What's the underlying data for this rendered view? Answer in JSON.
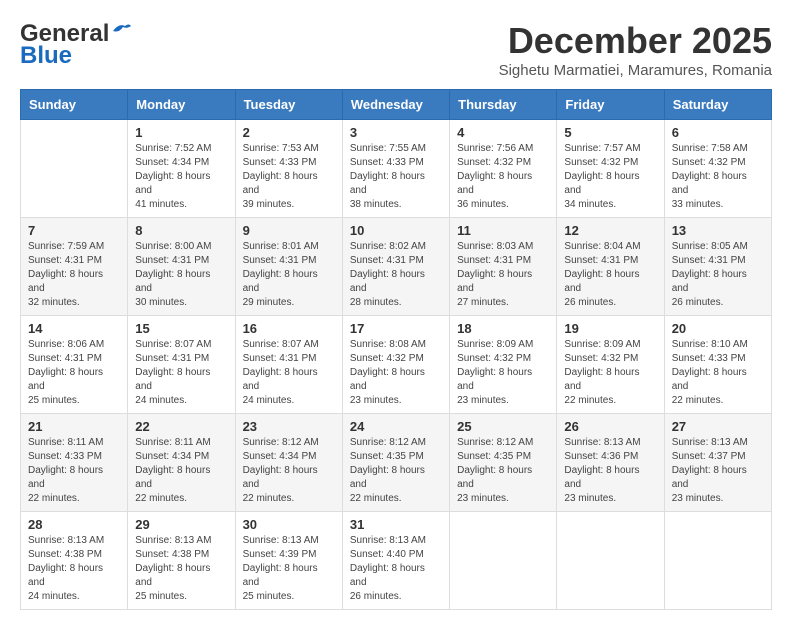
{
  "logo": {
    "general": "General",
    "blue": "Blue"
  },
  "title": "December 2025",
  "location": "Sighetu Marmatiei, Maramures, Romania",
  "days_of_week": [
    "Sunday",
    "Monday",
    "Tuesday",
    "Wednesday",
    "Thursday",
    "Friday",
    "Saturday"
  ],
  "weeks": [
    [
      {
        "day": "",
        "sunrise": "",
        "sunset": "",
        "daylight": ""
      },
      {
        "day": "1",
        "sunrise": "Sunrise: 7:52 AM",
        "sunset": "Sunset: 4:34 PM",
        "daylight": "Daylight: 8 hours and 41 minutes."
      },
      {
        "day": "2",
        "sunrise": "Sunrise: 7:53 AM",
        "sunset": "Sunset: 4:33 PM",
        "daylight": "Daylight: 8 hours and 39 minutes."
      },
      {
        "day": "3",
        "sunrise": "Sunrise: 7:55 AM",
        "sunset": "Sunset: 4:33 PM",
        "daylight": "Daylight: 8 hours and 38 minutes."
      },
      {
        "day": "4",
        "sunrise": "Sunrise: 7:56 AM",
        "sunset": "Sunset: 4:32 PM",
        "daylight": "Daylight: 8 hours and 36 minutes."
      },
      {
        "day": "5",
        "sunrise": "Sunrise: 7:57 AM",
        "sunset": "Sunset: 4:32 PM",
        "daylight": "Daylight: 8 hours and 34 minutes."
      },
      {
        "day": "6",
        "sunrise": "Sunrise: 7:58 AM",
        "sunset": "Sunset: 4:32 PM",
        "daylight": "Daylight: 8 hours and 33 minutes."
      }
    ],
    [
      {
        "day": "7",
        "sunrise": "Sunrise: 7:59 AM",
        "sunset": "Sunset: 4:31 PM",
        "daylight": "Daylight: 8 hours and 32 minutes."
      },
      {
        "day": "8",
        "sunrise": "Sunrise: 8:00 AM",
        "sunset": "Sunset: 4:31 PM",
        "daylight": "Daylight: 8 hours and 30 minutes."
      },
      {
        "day": "9",
        "sunrise": "Sunrise: 8:01 AM",
        "sunset": "Sunset: 4:31 PM",
        "daylight": "Daylight: 8 hours and 29 minutes."
      },
      {
        "day": "10",
        "sunrise": "Sunrise: 8:02 AM",
        "sunset": "Sunset: 4:31 PM",
        "daylight": "Daylight: 8 hours and 28 minutes."
      },
      {
        "day": "11",
        "sunrise": "Sunrise: 8:03 AM",
        "sunset": "Sunset: 4:31 PM",
        "daylight": "Daylight: 8 hours and 27 minutes."
      },
      {
        "day": "12",
        "sunrise": "Sunrise: 8:04 AM",
        "sunset": "Sunset: 4:31 PM",
        "daylight": "Daylight: 8 hours and 26 minutes."
      },
      {
        "day": "13",
        "sunrise": "Sunrise: 8:05 AM",
        "sunset": "Sunset: 4:31 PM",
        "daylight": "Daylight: 8 hours and 26 minutes."
      }
    ],
    [
      {
        "day": "14",
        "sunrise": "Sunrise: 8:06 AM",
        "sunset": "Sunset: 4:31 PM",
        "daylight": "Daylight: 8 hours and 25 minutes."
      },
      {
        "day": "15",
        "sunrise": "Sunrise: 8:07 AM",
        "sunset": "Sunset: 4:31 PM",
        "daylight": "Daylight: 8 hours and 24 minutes."
      },
      {
        "day": "16",
        "sunrise": "Sunrise: 8:07 AM",
        "sunset": "Sunset: 4:31 PM",
        "daylight": "Daylight: 8 hours and 24 minutes."
      },
      {
        "day": "17",
        "sunrise": "Sunrise: 8:08 AM",
        "sunset": "Sunset: 4:32 PM",
        "daylight": "Daylight: 8 hours and 23 minutes."
      },
      {
        "day": "18",
        "sunrise": "Sunrise: 8:09 AM",
        "sunset": "Sunset: 4:32 PM",
        "daylight": "Daylight: 8 hours and 23 minutes."
      },
      {
        "day": "19",
        "sunrise": "Sunrise: 8:09 AM",
        "sunset": "Sunset: 4:32 PM",
        "daylight": "Daylight: 8 hours and 22 minutes."
      },
      {
        "day": "20",
        "sunrise": "Sunrise: 8:10 AM",
        "sunset": "Sunset: 4:33 PM",
        "daylight": "Daylight: 8 hours and 22 minutes."
      }
    ],
    [
      {
        "day": "21",
        "sunrise": "Sunrise: 8:11 AM",
        "sunset": "Sunset: 4:33 PM",
        "daylight": "Daylight: 8 hours and 22 minutes."
      },
      {
        "day": "22",
        "sunrise": "Sunrise: 8:11 AM",
        "sunset": "Sunset: 4:34 PM",
        "daylight": "Daylight: 8 hours and 22 minutes."
      },
      {
        "day": "23",
        "sunrise": "Sunrise: 8:12 AM",
        "sunset": "Sunset: 4:34 PM",
        "daylight": "Daylight: 8 hours and 22 minutes."
      },
      {
        "day": "24",
        "sunrise": "Sunrise: 8:12 AM",
        "sunset": "Sunset: 4:35 PM",
        "daylight": "Daylight: 8 hours and 22 minutes."
      },
      {
        "day": "25",
        "sunrise": "Sunrise: 8:12 AM",
        "sunset": "Sunset: 4:35 PM",
        "daylight": "Daylight: 8 hours and 23 minutes."
      },
      {
        "day": "26",
        "sunrise": "Sunrise: 8:13 AM",
        "sunset": "Sunset: 4:36 PM",
        "daylight": "Daylight: 8 hours and 23 minutes."
      },
      {
        "day": "27",
        "sunrise": "Sunrise: 8:13 AM",
        "sunset": "Sunset: 4:37 PM",
        "daylight": "Daylight: 8 hours and 23 minutes."
      }
    ],
    [
      {
        "day": "28",
        "sunrise": "Sunrise: 8:13 AM",
        "sunset": "Sunset: 4:38 PM",
        "daylight": "Daylight: 8 hours and 24 minutes."
      },
      {
        "day": "29",
        "sunrise": "Sunrise: 8:13 AM",
        "sunset": "Sunset: 4:38 PM",
        "daylight": "Daylight: 8 hours and 25 minutes."
      },
      {
        "day": "30",
        "sunrise": "Sunrise: 8:13 AM",
        "sunset": "Sunset: 4:39 PM",
        "daylight": "Daylight: 8 hours and 25 minutes."
      },
      {
        "day": "31",
        "sunrise": "Sunrise: 8:13 AM",
        "sunset": "Sunset: 4:40 PM",
        "daylight": "Daylight: 8 hours and 26 minutes."
      },
      {
        "day": "",
        "sunrise": "",
        "sunset": "",
        "daylight": ""
      },
      {
        "day": "",
        "sunrise": "",
        "sunset": "",
        "daylight": ""
      },
      {
        "day": "",
        "sunrise": "",
        "sunset": "",
        "daylight": ""
      }
    ]
  ]
}
